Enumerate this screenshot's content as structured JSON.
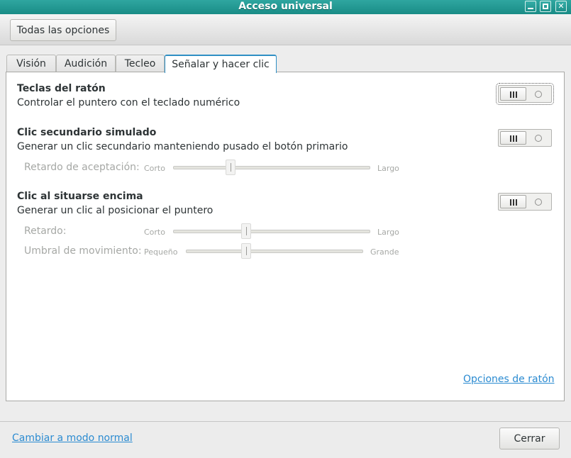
{
  "window": {
    "title": "Acceso universal"
  },
  "toolbar": {
    "all_options": "Todas las opciones"
  },
  "tabs": [
    {
      "label": "Visión"
    },
    {
      "label": "Audición"
    },
    {
      "label": "Tecleo"
    },
    {
      "label": "Señalar y hacer clic",
      "active": true
    }
  ],
  "sections": {
    "mouse_keys": {
      "title": "Teclas del ratón",
      "description": "Controlar el puntero con el teclado numérico",
      "enabled": false
    },
    "secondary_click": {
      "title": "Clic secundario simulado",
      "description": "Generar un clic secundario manteniendo pusado el botón primario",
      "enabled": false,
      "delay": {
        "label": "Retardo de aceptación:",
        "min_label": "Corto",
        "max_label": "Largo",
        "value": 0.29
      }
    },
    "hover_click": {
      "title": "Clic al situarse encima",
      "description": "Generar un clic al posicionar el puntero",
      "enabled": false,
      "delay": {
        "label": "Retardo:",
        "min_label": "Corto",
        "max_label": "Largo",
        "value": 0.37
      },
      "threshold": {
        "label": "Umbral de movimiento:",
        "min_label": "Pequeño",
        "max_label": "Grande",
        "value": 0.34
      }
    }
  },
  "links": {
    "mouse_options": "Opciones de ratón",
    "normal_mode": "Cambiar a modo normal"
  },
  "footer": {
    "close": "Cerrar"
  },
  "icons": {
    "minimize": "minimize-icon",
    "maximize": "maximize-icon",
    "close": "close-icon",
    "switch_on": "switch-bars-icon",
    "switch_off": "switch-ring-icon"
  },
  "colors": {
    "titlebar": "#1f948e",
    "accent": "#2e8fc4",
    "link": "#2b8bd1"
  }
}
